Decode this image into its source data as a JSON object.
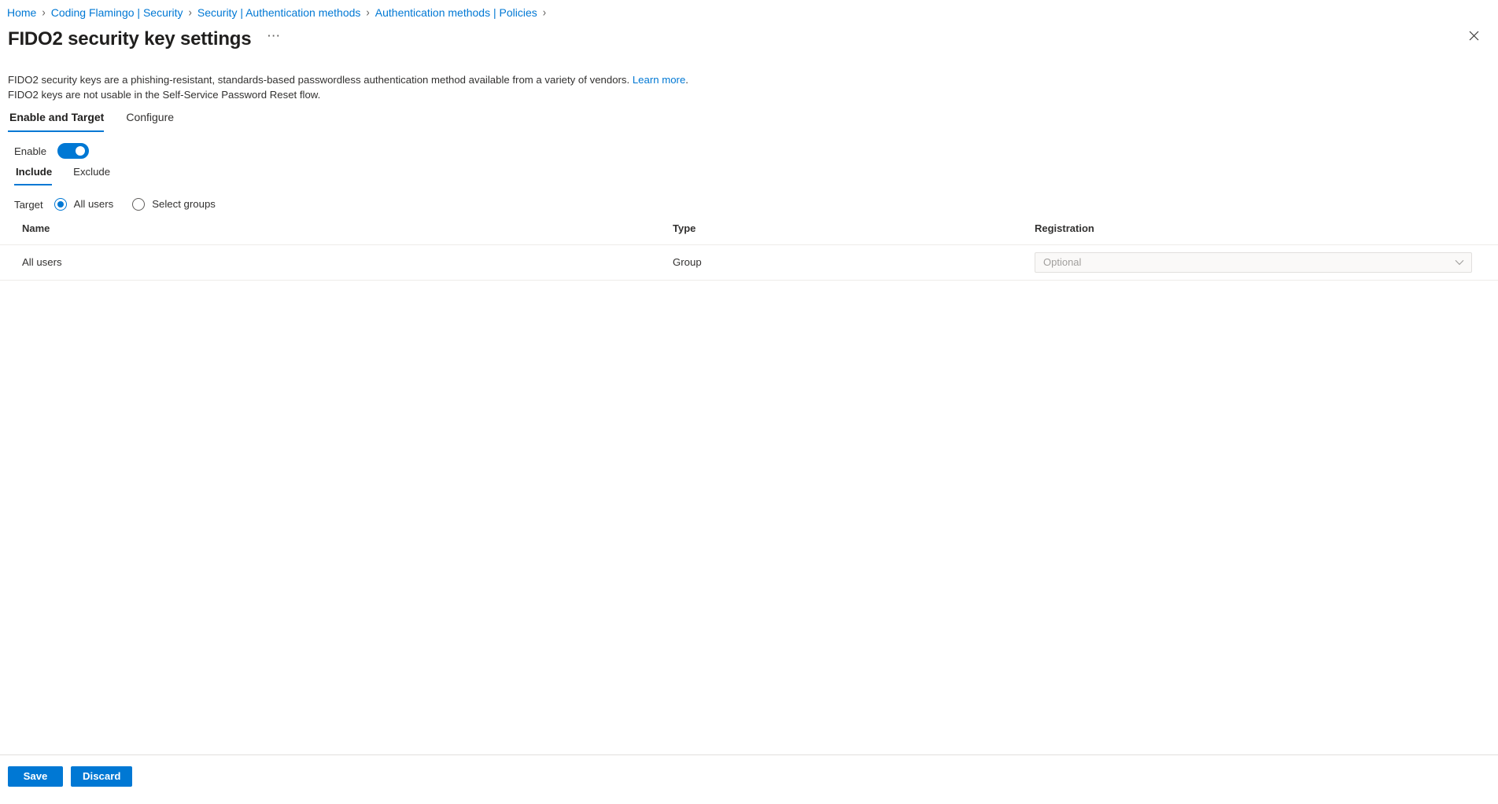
{
  "breadcrumb": {
    "separator": "›",
    "items": [
      {
        "label": "Home"
      },
      {
        "label": "Coding Flamingo | Security"
      },
      {
        "label": "Security | Authentication methods"
      },
      {
        "label": "Authentication methods | Policies"
      }
    ]
  },
  "header": {
    "title": "FIDO2 security key settings",
    "more_menu_label": "⋯",
    "more_menu_icon": "ellipsis-icon",
    "close_icon": "close-icon"
  },
  "description": {
    "line1_text": "FIDO2 security keys are a phishing-resistant, standards-based passwordless authentication method available from a variety of vendors. ",
    "learn_more_label": "Learn more",
    "line1_suffix": ".",
    "line2_text": "FIDO2 keys are not usable in the Self-Service Password Reset flow."
  },
  "tabs": {
    "items": [
      {
        "label": "Enable and Target",
        "active": true
      },
      {
        "label": "Configure",
        "active": false
      }
    ]
  },
  "enable": {
    "label": "Enable",
    "state": "on"
  },
  "subtabs": {
    "items": [
      {
        "label": "Include",
        "active": true
      },
      {
        "label": "Exclude",
        "active": false
      }
    ]
  },
  "target": {
    "label": "Target",
    "options": [
      {
        "label": "All users",
        "checked": true
      },
      {
        "label": "Select groups",
        "checked": false
      }
    ]
  },
  "table": {
    "columns": [
      {
        "label": "Name"
      },
      {
        "label": "Type"
      },
      {
        "label": "Registration"
      }
    ],
    "rows": [
      {
        "name": "All users",
        "type": "Group",
        "registration": "Optional"
      }
    ]
  },
  "footer": {
    "save_label": "Save",
    "discard_label": "Discard"
  },
  "colors": {
    "accent": "#0078d4",
    "link": "#0078d4",
    "text": "#323130",
    "border": "#e1dfdd",
    "row_border": "#edebe9",
    "disabled_text": "#a19f9d",
    "field_bg": "#faf9f8"
  }
}
